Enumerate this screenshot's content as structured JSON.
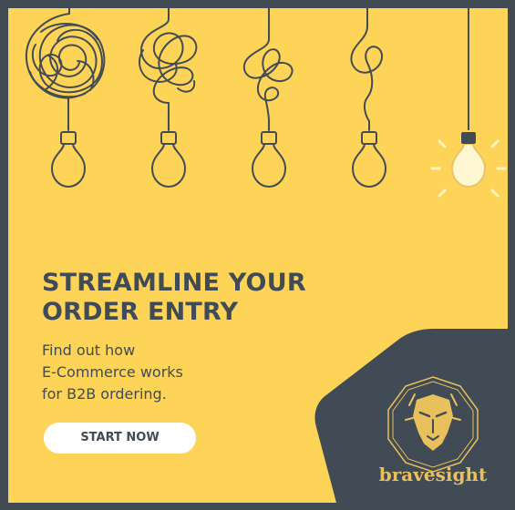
{
  "headline": {
    "line1": "STREAMLINE YOUR",
    "line2": "ORDER ENTRY"
  },
  "subcopy": {
    "line1": "Find out how",
    "line2": "E-Commerce works",
    "line3": "for B2B ordering."
  },
  "cta": {
    "label": "START NOW"
  },
  "brand": {
    "name": "bravesight"
  },
  "colors": {
    "background": "#fdd457",
    "frame": "#3f4a52",
    "ink": "#414b55",
    "brand_gold": "#e8c15c",
    "button": "#ffffff"
  },
  "icons": [
    "tangled-bulb-icon",
    "lit-bulb-icon",
    "lion-head-icon"
  ]
}
